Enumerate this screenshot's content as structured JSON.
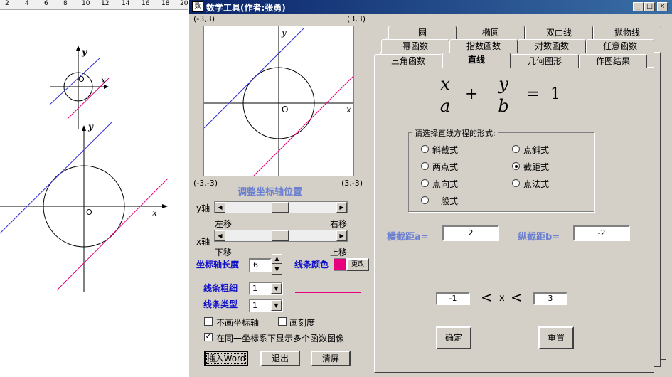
{
  "ruler": {
    "ticks": [
      "2",
      "4",
      "6",
      "8",
      "10",
      "12",
      "14",
      "16",
      "18",
      "20"
    ]
  },
  "doc": {
    "small_graph": {
      "y_label": "y",
      "x_label": "x",
      "origin_label": "O"
    },
    "large_graph": {
      "y_label": "y",
      "x_label": "x",
      "origin_label": "O"
    }
  },
  "window": {
    "title": "数学工具(作者:张勇)",
    "icon_text": "数",
    "controls": {
      "minimize": "_",
      "maximize": "□",
      "close": "×"
    }
  },
  "plot": {
    "top_left": "(-3,3)",
    "top_right": "(3,3)",
    "bottom_left": "(-3,-3)",
    "bottom_right": "(3,-3)",
    "y_label": "y",
    "x_label": "x",
    "origin_label": "O"
  },
  "axis_adjust": {
    "title": "调整坐标轴位置",
    "y_axis_label": "y轴",
    "x_axis_label": "x轴",
    "left_move": "左移",
    "right_move": "右移",
    "down_move": "下移",
    "up_move": "上移",
    "scroll_left": "◀",
    "scroll_right": "▶"
  },
  "settings": {
    "axis_length_label": "坐标轴长度",
    "axis_length_value": "6",
    "line_color_label": "线条颜色",
    "line_color_button": "更改",
    "line_color": "#e6007e",
    "line_width_label": "线条粗细",
    "line_width_value": "1",
    "line_type_label": "线条类型",
    "line_type_value": "1",
    "no_axis_label": "不画坐标轴",
    "no_axis_checked": false,
    "draw_ticks_label": "画刻度",
    "draw_ticks_checked": false,
    "multi_graph_label": "在同一坐标系下显示多个函数图像",
    "multi_graph_checked": true,
    "check_mark": "✓",
    "spin_up": "▲",
    "spin_down": "▼",
    "dropdown": "▼"
  },
  "buttons": {
    "insert_word": "插入Word",
    "exit": "退出",
    "clear": "清屏"
  },
  "tabs": {
    "row1": [
      "圆",
      "椭圆",
      "双曲线",
      "抛物线"
    ],
    "row2": [
      "幂函数",
      "指数函数",
      "对数函数",
      "任意函数"
    ],
    "row3": [
      "三角函数",
      "直线",
      "几何图形",
      "作图结果"
    ],
    "active": "直线"
  },
  "formula": {
    "x": "x",
    "a": "a",
    "y": "y",
    "b": "b",
    "plus": "+",
    "equals": "=",
    "one": "1"
  },
  "line_form": {
    "group_title": "请选择直线方程的形式:",
    "options": [
      "斜截式",
      "点斜式",
      "两点式",
      "截距式",
      "点向式",
      "点法式",
      "一般式"
    ],
    "selected": "截距式"
  },
  "intercepts": {
    "x_label": "横截距a=",
    "x_value": "2",
    "y_label": "纵截距b=",
    "y_value": "-2"
  },
  "range": {
    "min": "-1",
    "lt1": "<",
    "var": "x",
    "lt2": "<",
    "max": "3"
  },
  "actions": {
    "confirm": "确定",
    "reset": "重置"
  },
  "colors": {
    "blue_line": "#3030d0",
    "magenta_line": "#e6007e",
    "title_bar": "#0a246a",
    "label_blue": "#1010c8"
  }
}
